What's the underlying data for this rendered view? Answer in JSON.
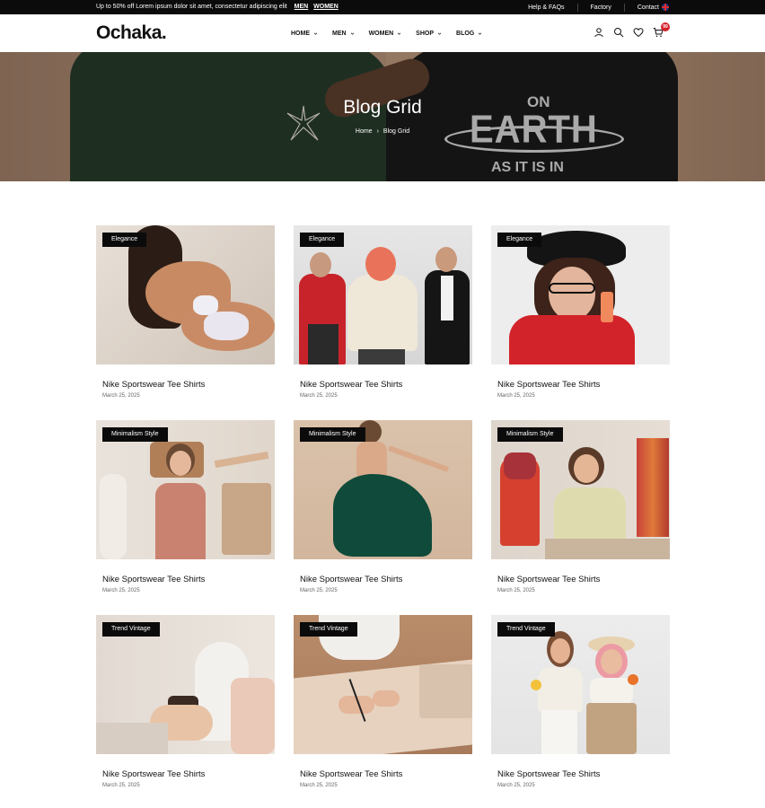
{
  "topbar": {
    "promo": "Up to 50% off Lorem ipsum dolor sit amet, consectetur adipiscing elit",
    "promo_links": [
      "MEN",
      "WOMEN"
    ],
    "links": [
      "Help & FAQs",
      "Factory",
      "Contact"
    ],
    "flag_icon": "uk-flag-icon"
  },
  "header": {
    "logo": "Ochaka.",
    "nav": [
      "HOME",
      "MEN",
      "WOMEN",
      "SHOP",
      "BLOG"
    ],
    "icons": [
      "user-icon",
      "search-icon",
      "heart-icon",
      "cart-icon"
    ],
    "cart_count": "99"
  },
  "hero": {
    "title": "Blog Grid",
    "breadcrumb": [
      "Home",
      "Blog Grid"
    ],
    "breadcrumb_sep": "›",
    "shirt_print": {
      "top": "ON",
      "middle": "EARTH",
      "bottom": "AS IT IS IN"
    }
  },
  "posts": [
    {
      "tag": "Elegance",
      "title": "Nike Sportswear Tee Shirts",
      "date": "March 25, 2025"
    },
    {
      "tag": "Elegance",
      "title": "Nike Sportswear Tee Shirts",
      "date": "March 25, 2025"
    },
    {
      "tag": "Elegance",
      "title": "Nike Sportswear Tee Shirts",
      "date": "March 25, 2025"
    },
    {
      "tag": "Minimalism Style",
      "title": "Nike Sportswear Tee Shirts",
      "date": "March 25, 2025"
    },
    {
      "tag": "Minimalism Style",
      "title": "Nike Sportswear Tee Shirts",
      "date": "March 25, 2025"
    },
    {
      "tag": "Minimalism Style",
      "title": "Nike Sportswear Tee Shirts",
      "date": "March 25, 2025"
    },
    {
      "tag": "Trend Vintage",
      "title": "Nike Sportswear Tee Shirts",
      "date": "March 25, 2025"
    },
    {
      "tag": "Trend Vintage",
      "title": "Nike Sportswear Tee Shirts",
      "date": "March 25, 2025"
    },
    {
      "tag": "Trend Vintage",
      "title": "Nike Sportswear Tee Shirts",
      "date": "March 25, 2025"
    }
  ],
  "colors": {
    "accent": "#0b0b0b",
    "badge": "#d3222a"
  }
}
